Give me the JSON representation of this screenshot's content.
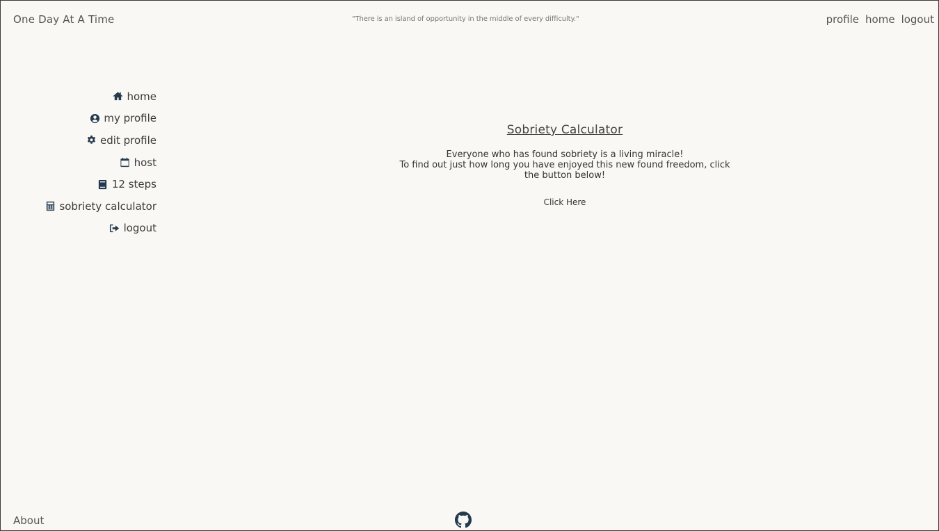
{
  "header": {
    "brand": "One Day At A Time",
    "quote": "\"There is an island of opportunity in the middle of every difficulty.\"",
    "nav": [
      {
        "label": "profile",
        "icon": ""
      },
      {
        "label": "home",
        "icon": ""
      },
      {
        "label": "logout",
        "icon": ""
      }
    ]
  },
  "sidebar": {
    "items": [
      {
        "label": "home",
        "icon": "home-icon"
      },
      {
        "label": "my profile",
        "icon": "user-circle-icon"
      },
      {
        "label": "edit profile",
        "icon": "gear-icon"
      },
      {
        "label": "host",
        "icon": "calendar-icon"
      },
      {
        "label": "12 steps",
        "icon": "book-icon"
      },
      {
        "label": "sobriety calculator",
        "icon": "calculator-icon"
      },
      {
        "label": "logout",
        "icon": "sign-out-icon"
      }
    ]
  },
  "main": {
    "title": "Sobriety Calculator",
    "line1": "Everyone who has found sobriety is a living miracle!",
    "line2": "To find out just how long you have enjoyed this new found freedom, click the button below!",
    "button_label": "Click Here"
  },
  "footer": {
    "about": "About",
    "github_icon": "github-icon"
  },
  "colors": {
    "background": "#f9f8f4",
    "icon": "#243a4f",
    "text": "#3a3a3a"
  }
}
